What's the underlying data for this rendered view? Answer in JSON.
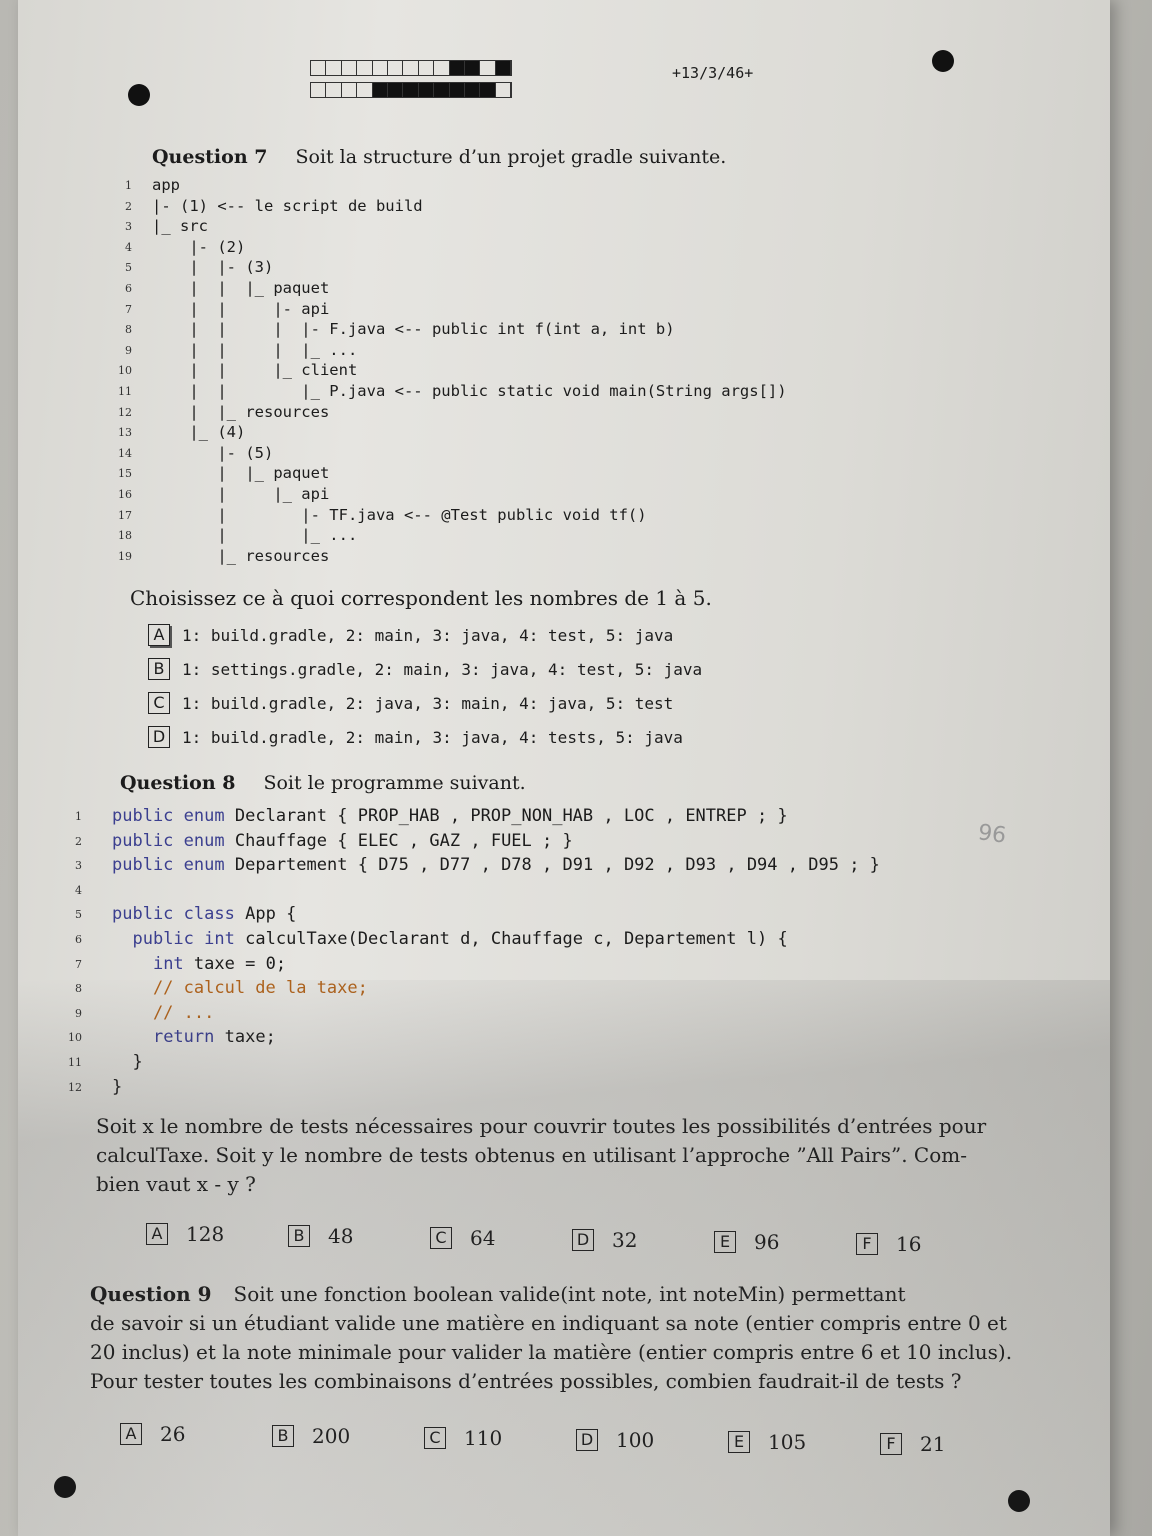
{
  "header": {
    "page_code": "+13/3/46+"
  },
  "q7": {
    "label": "Question 7",
    "text": "Soit la structure d’un projet gradle suivante.",
    "tree": [
      "app",
      "|- (1) <-- le script de build",
      "|_ src",
      "    |- (2)",
      "    |  |- (3)",
      "    |  |  |_ paquet",
      "    |  |     |- api",
      "    |  |     |  |- F.java <-- public int f(int a, int b)",
      "    |  |     |  |_ ...",
      "    |  |     |_ client",
      "    |  |        |_ P.java <-- public static void main(String args[])",
      "    |  |_ resources",
      "    |_ (4)",
      "       |- (5)",
      "       |  |_ paquet",
      "       |     |_ api",
      "       |        |- TF.java <-- @Test public void tf()",
      "       |        |_ ...",
      "       |_ resources"
    ],
    "prompt": "Choisissez ce à quoi correspondent les nombres de 1 à 5.",
    "options": [
      {
        "letter": "A",
        "text": "1: build.gradle, 2: main, 3: java, 4: test, 5: java"
      },
      {
        "letter": "B",
        "text": "1: settings.gradle, 2: main, 3: java, 4: test, 5: java"
      },
      {
        "letter": "C",
        "text": "1: build.gradle, 2: java, 3: main, 4: java, 5: test"
      },
      {
        "letter": "D",
        "text": "1: build.gradle, 2: main, 3: java, 4: tests, 5: java"
      }
    ]
  },
  "q8": {
    "label": "Question 8",
    "text": "Soit le programme suivant.",
    "code": [
      "public enum Declarant { PROP_HAB , PROP_NON_HAB , LOC , ENTREP ; }",
      "public enum Chauffage { ELEC , GAZ , FUEL ; }",
      "public enum Departement { D75 , D77 , D78 , D91 , D92 , D93 , D94 , D95 ; }",
      "",
      "public class App {",
      "  public int calculTaxe(Declarant d, Chauffage c, Departement l) {",
      "    int taxe = 0;",
      "    // calcul de la taxe;",
      "    // ...",
      "    return taxe;",
      "  }",
      "}"
    ],
    "question_lines": [
      "Soit x le nombre de tests nécessaires pour couvrir toutes les possibilités d’entrées pour",
      "calculTaxe. Soit y le nombre de tests obtenus en utilisant l’approche ”All Pairs”. Com-",
      "bien vaut x - y ?"
    ],
    "answers": [
      {
        "letter": "A",
        "value": "128"
      },
      {
        "letter": "B",
        "value": "48"
      },
      {
        "letter": "C",
        "value": "64"
      },
      {
        "letter": "D",
        "value": "32"
      },
      {
        "letter": "E",
        "value": "96"
      },
      {
        "letter": "F",
        "value": "16"
      }
    ],
    "pencil_note": "96"
  },
  "q9": {
    "label": "Question 9",
    "question_lines": [
      "Soit une fonction boolean valide(int note, int noteMin) permettant",
      "de savoir si un étudiant valide une matière en indiquant sa note (entier compris entre 0 et",
      "20 inclus) et la note minimale pour valider la matière (entier compris entre 6 et 10 inclus).",
      "Pour tester toutes les combinaisons d’entrées possibles, combien faudrait-il de tests ?"
    ],
    "answers": [
      {
        "letter": "A",
        "value": "26"
      },
      {
        "letter": "B",
        "value": "200"
      },
      {
        "letter": "C",
        "value": "110"
      },
      {
        "letter": "D",
        "value": "100"
      },
      {
        "letter": "E",
        "value": "105"
      },
      {
        "letter": "F",
        "value": "21"
      }
    ]
  }
}
